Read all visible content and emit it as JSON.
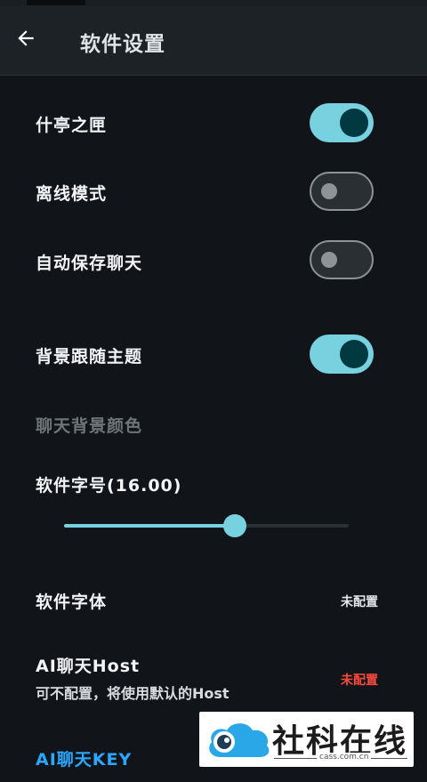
{
  "header": {
    "title": "软件设置",
    "back_icon": "arrow-left-icon"
  },
  "settings": {
    "shiting": {
      "label": "什亭之匣",
      "enabled": true
    },
    "offline": {
      "label": "离线模式",
      "enabled": false
    },
    "autosave": {
      "label": "自动保存聊天",
      "enabled": false
    },
    "bg_follow_theme": {
      "label": "背景跟随主题",
      "enabled": true
    },
    "chat_bg_color": {
      "label": "聊天背景颜色"
    },
    "font_size": {
      "label": "软件字号(16.00)",
      "value": 16.0,
      "fraction": 0.6
    },
    "font": {
      "label": "软件字体",
      "value": "未配置"
    },
    "ai_host": {
      "label": "AI聊天Host",
      "description": "可不配置，将使用默认的Host",
      "value": "未配置"
    },
    "ai_key": {
      "label": "AI聊天KEY"
    }
  },
  "colors": {
    "accent": "#78d1df",
    "thumb_on": "#003a40",
    "warning": "#ff4b3e",
    "link": "#2ba7ff",
    "background": "#111519",
    "appbar": "#1d2226"
  },
  "watermark": {
    "text": "社科在线",
    "url": "cass.com.cn"
  }
}
